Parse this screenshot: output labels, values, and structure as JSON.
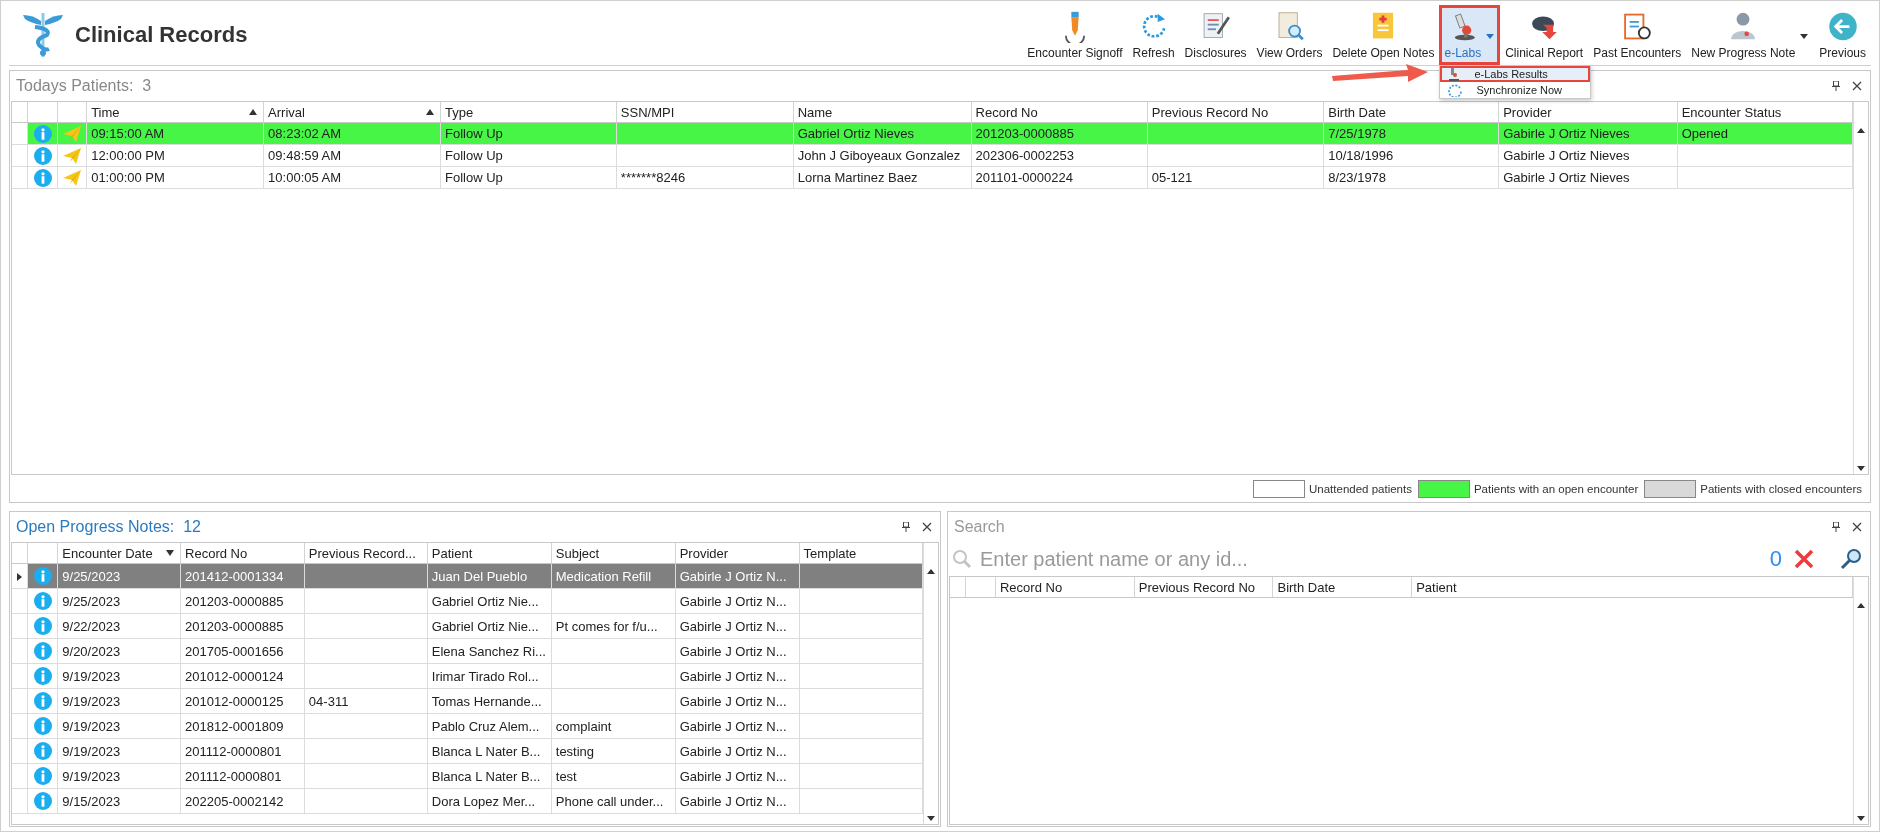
{
  "app": {
    "title": "Clinical Records"
  },
  "toolbar": [
    {
      "label": "Encounter Signoff",
      "selected": false,
      "menu": false,
      "highlighted": false
    },
    {
      "label": "Refresh",
      "selected": false,
      "menu": false,
      "highlighted": false
    },
    {
      "label": "Disclosures",
      "selected": false,
      "menu": false,
      "highlighted": false
    },
    {
      "label": "View Orders",
      "selected": false,
      "menu": false,
      "highlighted": false
    },
    {
      "label": "Delete Open Notes",
      "selected": false,
      "menu": false,
      "highlighted": false
    },
    {
      "label": "e-Labs",
      "selected": true,
      "menu": true,
      "highlighted": true
    },
    {
      "label": "Clinical Report",
      "selected": false,
      "menu": false,
      "highlighted": false
    },
    {
      "label": "Past Encounters",
      "selected": false,
      "menu": false,
      "highlighted": false
    },
    {
      "label": "New Progress Note",
      "selected": false,
      "menu": true,
      "highlighted": false
    },
    {
      "label": "Previous",
      "selected": false,
      "menu": false,
      "highlighted": false
    }
  ],
  "elabs_menu": [
    {
      "label": "e-Labs Results",
      "selected": true,
      "highlighted": true
    },
    {
      "label": "Synchronize Now",
      "selected": false,
      "highlighted": false
    }
  ],
  "todays_patients": {
    "title": "Todays Patients:",
    "count": "3",
    "columns": [
      {
        "label": "Time",
        "sort_ascending": true
      },
      {
        "label": "Arrival",
        "sort_ascending": true
      },
      {
        "label": "Type"
      },
      {
        "label": "SSN/MPI"
      },
      {
        "label": "Name"
      },
      {
        "label": "Record No"
      },
      {
        "label": "Previous Record No"
      },
      {
        "label": "Birth Date"
      },
      {
        "label": "Provider"
      },
      {
        "label": "Encounter Status"
      }
    ],
    "rows": [
      {
        "color": "#47f547",
        "cells": [
          "09:15:00 AM",
          "08:23:02 AM",
          "Follow Up",
          "",
          "Gabriel Ortiz Nieves",
          "201203-0000885",
          "",
          "7/25/1978",
          "Gabirle J Ortiz Nieves",
          "Opened"
        ]
      },
      {
        "color": "#ffffff",
        "cells": [
          "12:00:00 PM",
          "09:48:59 AM",
          "Follow Up",
          "",
          "John J Giboyeaux Gonzalez",
          "202306-0002253",
          "",
          "10/18/1996",
          "Gabirle J Ortiz Nieves",
          ""
        ]
      },
      {
        "color": "#ffffff",
        "cells": [
          "01:00:00 PM",
          "10:00:05 AM",
          "Follow Up",
          "*******8246",
          "Lorna Martinez Baez",
          "201101-0000224",
          "05-121",
          "8/23/1978",
          "Gabirle J Ortiz Nieves",
          ""
        ]
      }
    ]
  },
  "legend": [
    {
      "label": "Unattended patients",
      "color": "#ffffff"
    },
    {
      "label": "Patients with an open encounter",
      "color": "#47f547"
    },
    {
      "label": "Patients with closed encounters",
      "color": "#d9d9d9"
    }
  ],
  "open_progress_notes": {
    "title": "Open Progress Notes:",
    "count": "12",
    "columns": [
      {
        "label": "Encounter Date",
        "sort_descending": true
      },
      {
        "label": "Record No"
      },
      {
        "label": "Previous Record..."
      },
      {
        "label": "Patient"
      },
      {
        "label": "Subject"
      },
      {
        "label": "Provider"
      },
      {
        "label": "Template"
      }
    ],
    "rows": [
      {
        "selected": true,
        "cells": [
          "9/25/2023",
          "201412-0001334",
          "",
          "Juan Del Pueblo",
          "Medication Refill",
          "Gabirle J Ortiz N...",
          ""
        ]
      },
      {
        "selected": false,
        "cells": [
          "9/25/2023",
          "201203-0000885",
          "",
          "Gabriel Ortiz Nie...",
          "",
          "Gabirle J Ortiz N...",
          ""
        ]
      },
      {
        "selected": false,
        "cells": [
          "9/22/2023",
          "201203-0000885",
          "",
          "Gabriel Ortiz Nie...",
          "Pt comes for f/u...",
          "Gabirle J Ortiz N...",
          ""
        ]
      },
      {
        "selected": false,
        "cells": [
          "9/20/2023",
          "201705-0001656",
          "",
          "Elena Sanchez Ri...",
          "",
          "Gabirle J Ortiz N...",
          ""
        ]
      },
      {
        "selected": false,
        "cells": [
          "9/19/2023",
          "201012-0000124",
          "",
          "Irimar Tirado Rol...",
          "",
          "Gabirle J Ortiz N...",
          ""
        ]
      },
      {
        "selected": false,
        "cells": [
          "9/19/2023",
          "201012-0000125",
          "04-311",
          "Tomas Hernande...",
          "",
          "Gabirle J Ortiz N...",
          ""
        ]
      },
      {
        "selected": false,
        "cells": [
          "9/19/2023",
          "201812-0001809",
          "",
          "Pablo Cruz Alem...",
          "complaint",
          "Gabirle J Ortiz N...",
          ""
        ]
      },
      {
        "selected": false,
        "cells": [
          "9/19/2023",
          "201112-0000801",
          "",
          "Blanca L Nater B...",
          "testing",
          "Gabirle J Ortiz N...",
          ""
        ]
      },
      {
        "selected": false,
        "cells": [
          "9/19/2023",
          "201112-0000801",
          "",
          "Blanca L Nater B...",
          "test",
          "Gabirle J Ortiz N...",
          ""
        ]
      },
      {
        "selected": false,
        "cells": [
          "9/15/2023",
          "202205-0002142",
          "",
          "Dora Lopez Mer...",
          "Phone call under...",
          "Gabirle J Ortiz N...",
          ""
        ]
      }
    ]
  },
  "search": {
    "title": "Search",
    "placeholder": "Enter patient name or any id...",
    "count": "0",
    "columns": [
      {
        "label": "Record No"
      },
      {
        "label": "Previous Record No"
      },
      {
        "label": "Birth Date"
      },
      {
        "label": "Patient"
      }
    ]
  }
}
